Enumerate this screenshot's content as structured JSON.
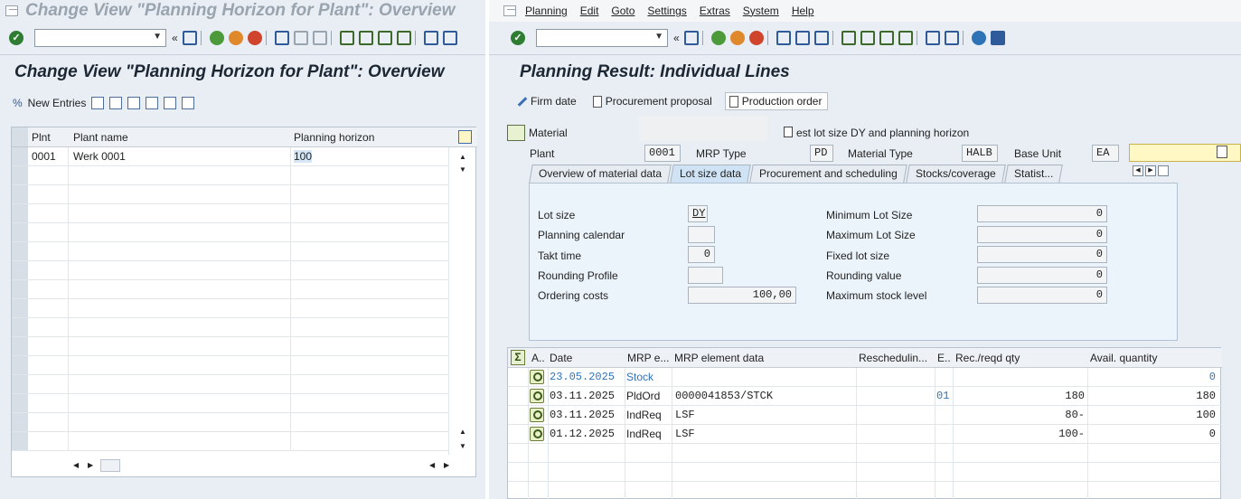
{
  "left": {
    "window_title": "Change View \"Planning Horizon for Plant\": Overview",
    "screen_title": "Change View \"Planning Horizon for Plant\": Overview",
    "new_entries_label": "New Entries",
    "table": {
      "headers": [
        "Plnt",
        "Plant name",
        "Planning horizon"
      ],
      "rows": [
        {
          "plant": "0001",
          "name": "Werk 0001",
          "horizon": "100"
        }
      ]
    }
  },
  "right": {
    "menu": [
      "Planning",
      "Edit",
      "Goto",
      "Settings",
      "Extras",
      "System",
      "Help"
    ],
    "screen_title": "Planning Result: Individual Lines",
    "buttons": {
      "firm_date": "Firm date",
      "procurement_proposal": "Procurement proposal",
      "production_order": "Production order"
    },
    "material": {
      "label": "Material",
      "description": "est lot size DY and planning horizon",
      "plant_label": "Plant",
      "plant": "0001",
      "mrp_type_label": "MRP Type",
      "mrp_type": "PD",
      "material_type_label": "Material Type",
      "material_type": "HALB",
      "base_unit_label": "Base Unit",
      "base_unit": "EA"
    },
    "tabs": [
      "Overview of material data",
      "Lot size data",
      "Procurement and scheduling",
      "Stocks/coverage",
      "Statist..."
    ],
    "lot_size": {
      "lot_size_label": "Lot size",
      "lot_size": "DY",
      "planning_calendar_label": "Planning calendar",
      "planning_calendar": "",
      "takt_time_label": "Takt time",
      "takt_time": "0",
      "rounding_profile_label": "Rounding Profile",
      "rounding_profile": "",
      "ordering_costs_label": "Ordering costs",
      "ordering_costs": "100,00",
      "min_lot_size_label": "Minimum Lot Size",
      "min_lot_size": "0",
      "max_lot_size_label": "Maximum Lot Size",
      "max_lot_size": "0",
      "fixed_lot_size_label": "Fixed lot size",
      "fixed_lot_size": "0",
      "rounding_value_label": "Rounding value",
      "rounding_value": "0",
      "max_stock_label": "Maximum stock level",
      "max_stock": "0"
    },
    "table": {
      "headers": [
        "A..",
        "Date",
        "MRP e...",
        "MRP element data",
        "Reschedulin...",
        "E..",
        "Rec./reqd qty",
        "Avail. quantity"
      ],
      "rows": [
        {
          "date": "23.05.2025",
          "mrp_element": "Stock",
          "data": "",
          "resched": "",
          "e": "",
          "qty": "",
          "avail": "0"
        },
        {
          "date": "03.11.2025",
          "mrp_element": "PldOrd",
          "data": "0000041853/STCK",
          "resched": "",
          "e": "01",
          "qty": "180",
          "avail": "180"
        },
        {
          "date": "03.11.2025",
          "mrp_element": "IndReq",
          "data": "LSF",
          "resched": "",
          "e": "",
          "qty": "80-",
          "avail": "100"
        },
        {
          "date": "01.12.2025",
          "mrp_element": "IndReq",
          "data": "LSF",
          "resched": "",
          "e": "",
          "qty": "100-",
          "avail": "0"
        }
      ]
    }
  },
  "colors": {
    "accent": "#2f73b7",
    "ok_green": "#2e7d32",
    "selection": "#d5e7f7"
  }
}
